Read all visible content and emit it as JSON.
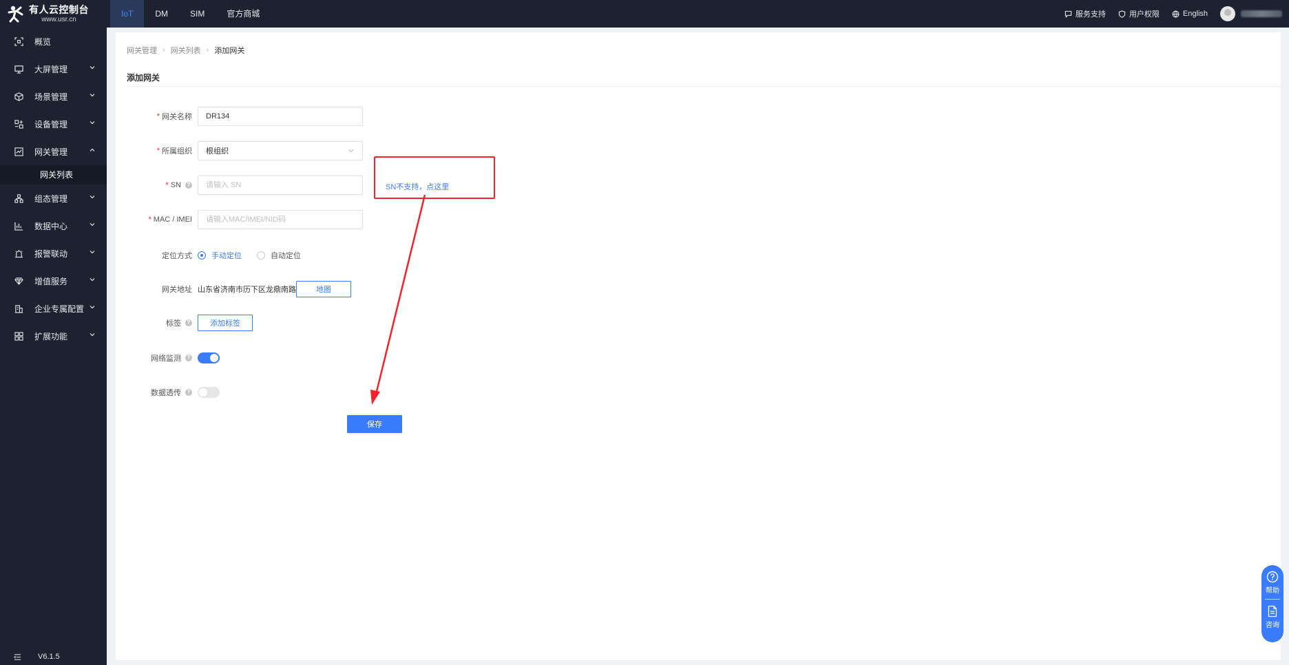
{
  "brand": {
    "title": "有人云控制台",
    "subtitle": "www.usr.cn"
  },
  "top_tabs": [
    {
      "label": "IoT",
      "active": true
    },
    {
      "label": "DM",
      "active": false
    },
    {
      "label": "SIM",
      "active": false
    },
    {
      "label": "官方商城",
      "active": false
    }
  ],
  "top_right": {
    "support": "服务支持",
    "permissions": "用户权限",
    "language": "English"
  },
  "sidebar": {
    "items": [
      {
        "label": "概览",
        "icon": "overview-icon"
      },
      {
        "label": "大屏管理",
        "icon": "screen-icon"
      },
      {
        "label": "场景管理",
        "icon": "scene-icon"
      },
      {
        "label": "设备管理",
        "icon": "device-icon"
      },
      {
        "label": "网关管理",
        "icon": "gateway-icon"
      },
      {
        "label": "组态管理",
        "icon": "config-icon"
      },
      {
        "label": "数据中心",
        "icon": "data-icon"
      },
      {
        "label": "报警联动",
        "icon": "alarm-icon"
      },
      {
        "label": "增值服务",
        "icon": "diamond-icon"
      },
      {
        "label": "企业专属配置",
        "icon": "enterprise-icon"
      },
      {
        "label": "扩展功能",
        "icon": "grid-icon"
      }
    ],
    "sub_active": "网关列表",
    "version": "V6.1.5"
  },
  "breadcrumb": [
    "网关管理",
    "网关列表",
    "添加网关"
  ],
  "page_title": "添加网关",
  "form": {
    "name_label": "网关名称",
    "name_value": "DR134",
    "org_label": "所属组织",
    "org_value": "根组织",
    "sn_label": "SN",
    "sn_placeholder": "请输入 SN",
    "mac_label": "MAC / IMEI",
    "mac_placeholder": "请输入MAC/IMEI/NID码",
    "locate_label": "定位方式",
    "locate_manual": "手动定位",
    "locate_auto": "自动定位",
    "address_label": "网关地址",
    "address_value": "山东省济南市历下区龙鼎南路",
    "map_button": "地图",
    "tag_label": "标签",
    "tag_button": "添加标签",
    "network_label": "网络监测",
    "network_on": true,
    "passthrough_label": "数据透传",
    "passthrough_on": false,
    "save_button": "保存"
  },
  "annotation": {
    "sn_hint": "SN不支持，点这里",
    "box_color": "#f5222d"
  },
  "float_help": {
    "help": "帮助",
    "consult": "咨询"
  },
  "colors": {
    "primary": "#3b7cff",
    "nav_bg": "#1c2230",
    "required": "#f5222d"
  }
}
